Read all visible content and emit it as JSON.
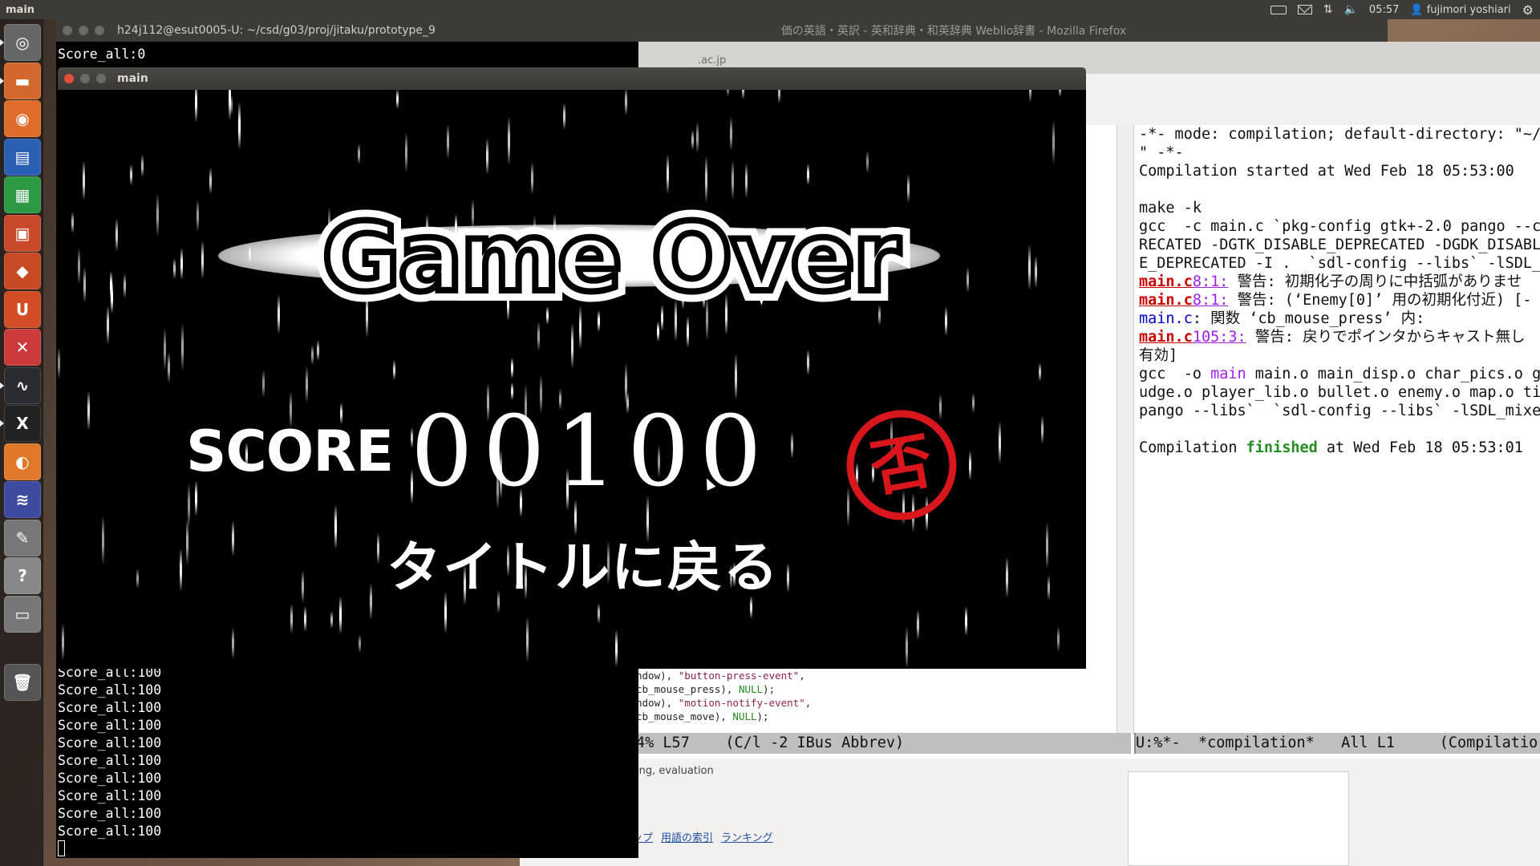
{
  "top_panel": {
    "app_name": "main",
    "time": "05:57",
    "user": "fujimori yoshiari"
  },
  "launcher": {
    "items": [
      "dash-icon",
      "files-icon",
      "firefox-icon",
      "writer-icon",
      "calc-icon",
      "impress-icon",
      "software-center-icon",
      "ubuntu-one-icon",
      "settings-icon",
      "system-monitor-icon",
      "xterm-icon",
      "browser-icon",
      "editor-icon",
      "text-editor-icon",
      "help-icon",
      "workspaces-icon",
      "trash-icon"
    ],
    "colors": [
      "#666",
      "#d0692b",
      "#e06c2c",
      "#2a60b3",
      "#2e9944",
      "#c94a2b",
      "#c74a25",
      "#d24d23",
      "#cc3b3b",
      "#2a2c30",
      "#222",
      "#e07a2a",
      "#3c4aa0",
      "#777",
      "#888",
      "#777",
      "#555"
    ]
  },
  "terminal": {
    "title": "h24j112@esut0005-U: ~/csd/g03/proj/jitaku/prototype_9",
    "first_line": "Score_all:0",
    "lines": [
      "Score_all:100",
      "Score_all:100",
      "Score_all:100",
      "Score_all:100",
      "Score_all:100",
      "Score_all:100",
      "Score_all:100",
      "Score_all:100",
      "Score_all:100",
      "Score_all:100"
    ]
  },
  "browser": {
    "title": "価の英語・英訳 - 英和辞典・和英辞典 Weblio辞書 - Mozilla Firefox",
    "url_fragment": ".ac.jp",
    "text_fragment": "ing, evaluation",
    "links": [
      "ップ",
      "用語の索引",
      "ランキング"
    ]
  },
  "emacs": {
    "code_lines": [
      {
        "a": "ndow), ",
        "s": "\"button-press-event\"",
        "b": ","
      },
      {
        "a": "cb_mouse_press), ",
        "s": "NULL",
        "b": ");"
      },
      {
        "a": "ndow), ",
        "s": "\"motion-notify-event\"",
        "b": ","
      },
      {
        "a": "cb_mouse_move), ",
        "s": "NULL",
        "b": ");"
      }
    ],
    "modeline_left": "4% L57    (C/l -2 IBus Abbrev)",
    "modeline_right": "U:%*-  *compilation*   All L1     (Compilatio",
    "compile": {
      "l1": "-*- mode: compilation; default-directory: \"~/",
      "l2": "\" -*-",
      "l3": "Compilation started at Wed Feb 18 05:53:00",
      "l4": "",
      "l5": "make -k",
      "l6": "gcc  -c main.c `pkg-config gtk+-2.0 pango --c",
      "l7": "RECATED -DGTK_DISABLE_DEPRECATED -DGDK_DISABL",
      "l8": "E_DEPRECATED -I .  `sdl-config --libs` -lSDL_",
      "w1_link": "main.c",
      "w1_ln": "8:1:",
      "w1_msg": " 警告: 初期化子の周りに中括弧がありませ",
      "w2_link": "main.c",
      "w2_ln": "8:1:",
      "w2_msg": " 警告: (‘Enemy[0]’ 用の初期化付近) [-",
      "w3_fn": "main.c",
      "w3_msg": ": 関数 ‘cb_mouse_press’ 内:",
      "w4_link": "main.c",
      "w4_ln": "105:3:",
      "w4_msg": " 警告: 戻りでポインタからキャスト無し",
      "l9": "有効]",
      "l10a": "gcc  -o ",
      "l10main": "main",
      "l10b": " main.o main_disp.o char_pics.o g",
      "l11": "udge.o player_lib.o bullet.o enemy.o map.o ti",
      "l12": "pango --libs`  `sdl-config --libs` -lSDL_mixe",
      "fin_a": "Compilation ",
      "fin_b": "finished",
      "fin_c": " at Wed Feb 18 05:53:01"
    }
  },
  "game": {
    "window_title": "main",
    "heading": "Game Over",
    "score_label": "SCORE",
    "score_digits": [
      "0",
      "0",
      "1",
      "0",
      "0"
    ],
    "back_button": "タイトルに戻る",
    "stamp_char": "否",
    "stamp_color": "#d8161b"
  }
}
